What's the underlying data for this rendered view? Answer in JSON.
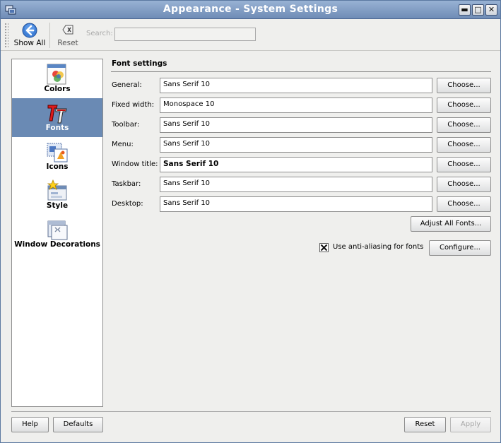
{
  "window": {
    "title": "Appearance - System Settings"
  },
  "toolbar": {
    "show_all_label": "Show All",
    "reset_label": "Reset",
    "search_label": "Search:",
    "search_value": ""
  },
  "sidebar": {
    "items": [
      {
        "label": "Colors",
        "icon": "colors-icon"
      },
      {
        "label": "Fonts",
        "icon": "fonts-icon",
        "selected": true
      },
      {
        "label": "Icons",
        "icon": "icons-icon"
      },
      {
        "label": "Style",
        "icon": "style-icon"
      },
      {
        "label": "Window Decorations",
        "icon": "window-decorations-icon"
      }
    ]
  },
  "fonts": {
    "section_title": "Font settings",
    "choose_label": "Choose...",
    "rows": [
      {
        "label": "General:",
        "value": "Sans Serif 10"
      },
      {
        "label": "Fixed width:",
        "value": "Monospace 10"
      },
      {
        "label": "Toolbar:",
        "value": "Sans Serif 10"
      },
      {
        "label": "Menu:",
        "value": "Sans Serif 10"
      },
      {
        "label": "Window title:",
        "value": "Sans Serif 10"
      },
      {
        "label": "Taskbar:",
        "value": "Sans Serif 10"
      },
      {
        "label": "Desktop:",
        "value": "Sans Serif 10"
      }
    ],
    "adjust_all_label": "Adjust All Fonts...",
    "antialias_label": "Use anti-aliasing for fonts",
    "antialias_checked": true,
    "configure_label": "Configure..."
  },
  "footer": {
    "help_label": "Help",
    "defaults_label": "Defaults",
    "reset_label": "Reset",
    "apply_label": "Apply"
  },
  "colors": {
    "selection": "#6a8ab4",
    "titlebar": "#7f9bc2"
  }
}
